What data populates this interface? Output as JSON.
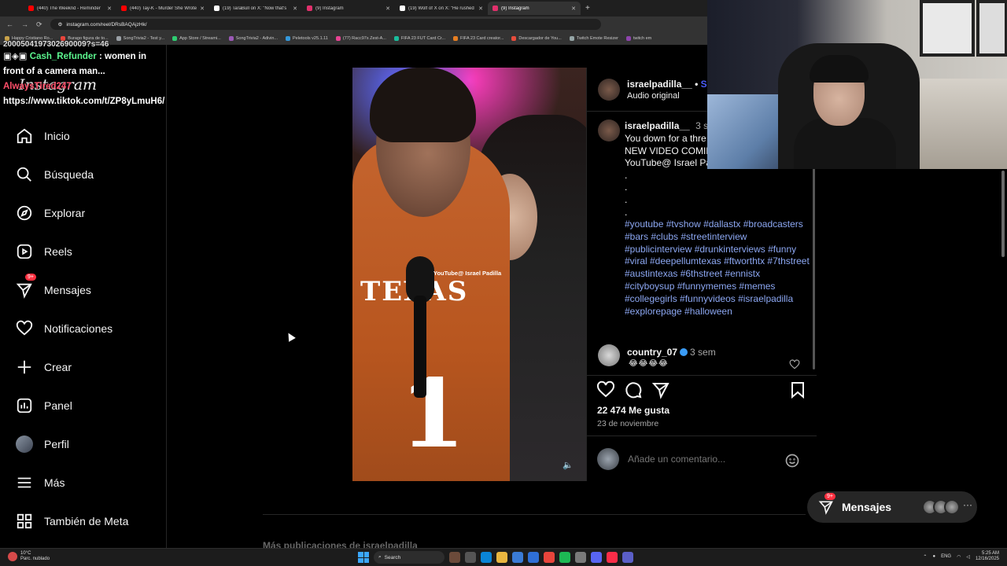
{
  "browser": {
    "tabs": [
      {
        "title": "(440) The Weeknd - Reminder",
        "color": "#ff0000"
      },
      {
        "title": "(440) Tay-K - Murder She Wrote",
        "color": "#ff0000"
      },
      {
        "title": "(19) TaraBull on X: \"Now that's",
        "color": "#ffffff"
      },
      {
        "title": "(9) Instagram",
        "color": "#e1306c"
      },
      {
        "title": "(19) Wolf of X on X: \"He rushed",
        "color": "#ffffff"
      },
      {
        "title": "(9) Instagram",
        "color": "#e1306c",
        "active": true
      }
    ],
    "url": "instagram.com/reel/DRsBAQAjzHk/",
    "bookmarks": [
      "Happy Cristiano Ro...",
      "Burago figura de to...",
      "SongTrivia2 - Test y...",
      "App Store / Streami...",
      "SongTrivia2 - Adivin...",
      "Peletools v25.1.11",
      "(77) Racc97s Zest-A...",
      "FIFA 23 FUT Card Cr...",
      "FIFA 23 Card creator...",
      "Descargador de You...",
      "Twitch Emote Resizer",
      "twitch em"
    ]
  },
  "chat": {
    "topline": "2000504197302690009?s=46",
    "line1_user": "Cash_Refunder",
    "line1_text": ": women in front of a camera man...",
    "line2_user": "AlwaysTired247",
    "line2_text": ": https://www.tiktok.com/t/ZP8yLmuH6/"
  },
  "sidebar": {
    "logo": "Instagram",
    "items": [
      {
        "label": "Inicio",
        "icon": "home-icon"
      },
      {
        "label": "Búsqueda",
        "icon": "search-icon"
      },
      {
        "label": "Explorar",
        "icon": "compass-icon"
      },
      {
        "label": "Reels",
        "icon": "reels-icon"
      },
      {
        "label": "Mensajes",
        "icon": "messenger-icon",
        "badge": "9+"
      },
      {
        "label": "Notificaciones",
        "icon": "heart-icon"
      },
      {
        "label": "Crear",
        "icon": "plus-icon"
      },
      {
        "label": "Panel",
        "icon": "dashboard-icon"
      },
      {
        "label": "Perfil",
        "icon": "avatar"
      },
      {
        "label": "Más",
        "icon": "menu-icon"
      },
      {
        "label": "También de Meta",
        "icon": "meta-icon"
      }
    ]
  },
  "reel": {
    "watermark": "YouTube@ Israel Padilla",
    "jersey_text": "TEXAS",
    "jersey_number": "1"
  },
  "post": {
    "username": "israelpadilla__",
    "follow": "Se",
    "audio": "Audio original",
    "caption_user": "israelpadilla__",
    "caption_age": "3 se",
    "caption_text": "You down for a thre\nNEW VIDEO COMIN\nYouTube@ Israel Pa\n.\n.\n.\n.",
    "hashtags": "#youtube #tvshow #dallastx #broadcasters #bars #clubs #streetinterview #publicinterview #drunkinterviews #funny #viral #deepellumtexas #ftworthtx #7thstreet #austintexas #6thstreet #ennistx #cityboysup #funnymemes #memes #collegegirls #funnyvideos #israelpadilla #explorepage #halloween",
    "comment_user": "country_07",
    "comment_age": "3 sem",
    "comment_text": "😂😂😂😂",
    "likes": "22 474 Me gusta",
    "date": "23 de noviembre",
    "comment_placeholder": "Añade un comentario..."
  },
  "messages_pill": {
    "label": "Mensajes",
    "badge": "9+"
  },
  "footer_text": "Más publicaciones de israelpadilla__",
  "taskbar": {
    "weather_temp": "10°C",
    "weather_desc": "Parc. nublado",
    "search": "Search",
    "lang": "ENG",
    "time": "5:25 AM",
    "date": "12/16/2025"
  }
}
